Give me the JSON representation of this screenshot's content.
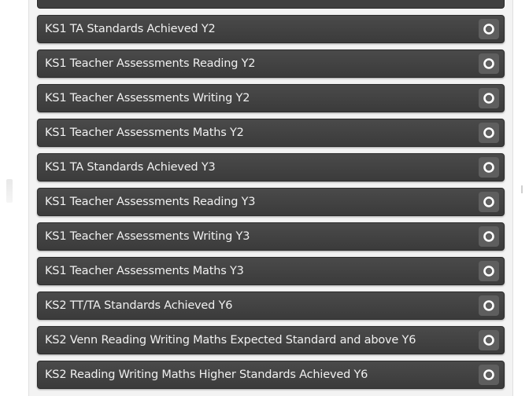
{
  "reports": {
    "items": [
      {
        "label": "KS1 TA Standards Achieved Y2",
        "icon": "circle-icon"
      },
      {
        "label": "KS1 Teacher Assessments Reading Y2",
        "icon": "circle-icon"
      },
      {
        "label": "KS1 Teacher Assessments Writing Y2",
        "icon": "circle-icon"
      },
      {
        "label": "KS1 Teacher Assessments Maths Y2",
        "icon": "circle-icon"
      },
      {
        "label": "KS1 TA Standards Achieved Y3",
        "icon": "circle-icon"
      },
      {
        "label": "KS1 Teacher Assessments Reading Y3",
        "icon": "circle-icon"
      },
      {
        "label": "KS1 Teacher Assessments Writing Y3",
        "icon": "circle-icon"
      },
      {
        "label": "KS1 Teacher Assessments Maths Y3",
        "icon": "circle-icon"
      },
      {
        "label": "KS2 TT/TA Standards Achieved Y6",
        "icon": "circle-icon"
      },
      {
        "label": "KS2 Venn Reading Writing Maths Expected Standard and above Y6",
        "icon": "circle-icon"
      },
      {
        "label": "KS2 Reading Writing Maths Higher Standards Achieved Y6",
        "icon": "circle-icon"
      }
    ]
  },
  "colors": {
    "item_background": "#404040",
    "item_text": "#f0f0f0",
    "button_background": "#5e5e5e"
  }
}
